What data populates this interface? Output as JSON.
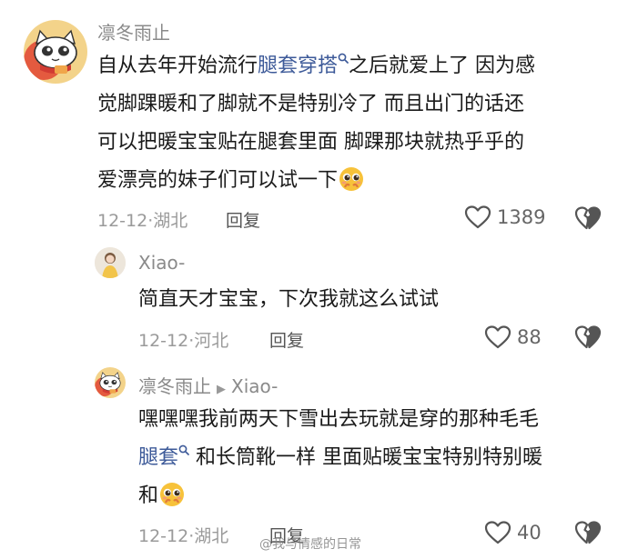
{
  "comments": [
    {
      "username": "凛冬雨止",
      "text_before_link": "自从去年开始流行",
      "link_text": "腿套穿搭",
      "text_after_link_line1": "之后就爱上了 因为感",
      "line2": "觉脚踝暖和了脚就不是特别冷了 而且出门的话还",
      "line3": "可以把暖宝宝贴在腿套里面 脚踝那块就热乎乎的",
      "line4": "爱漂亮的妹子们可以试一下",
      "date": "12-12",
      "location": "湖北",
      "reply_label": "回复",
      "like_count": "1389"
    },
    {
      "username": "Xiao-",
      "text": "简直天才宝宝，下次我就这么试试",
      "date": "12-12",
      "location": "河北",
      "reply_label": "回复",
      "like_count": "88"
    },
    {
      "username": "凛冬雨止",
      "reply_to": "Xiao-",
      "line1": "嘿嘿嘿我前两天下雪出去玩就是穿的那种毛毛",
      "link_text": "腿套",
      "line2_after_link": " 和长筒靴一样 里面贴暖宝宝特别特别暖",
      "line3": "和",
      "date": "12-12",
      "location": "湖北",
      "reply_label": "回复",
      "like_count": "40"
    }
  ],
  "watermark": "@我与情感的日常",
  "colors": {
    "link": "#3d5a99",
    "meta": "#9a9a9a",
    "username": "#8a8a8a"
  }
}
